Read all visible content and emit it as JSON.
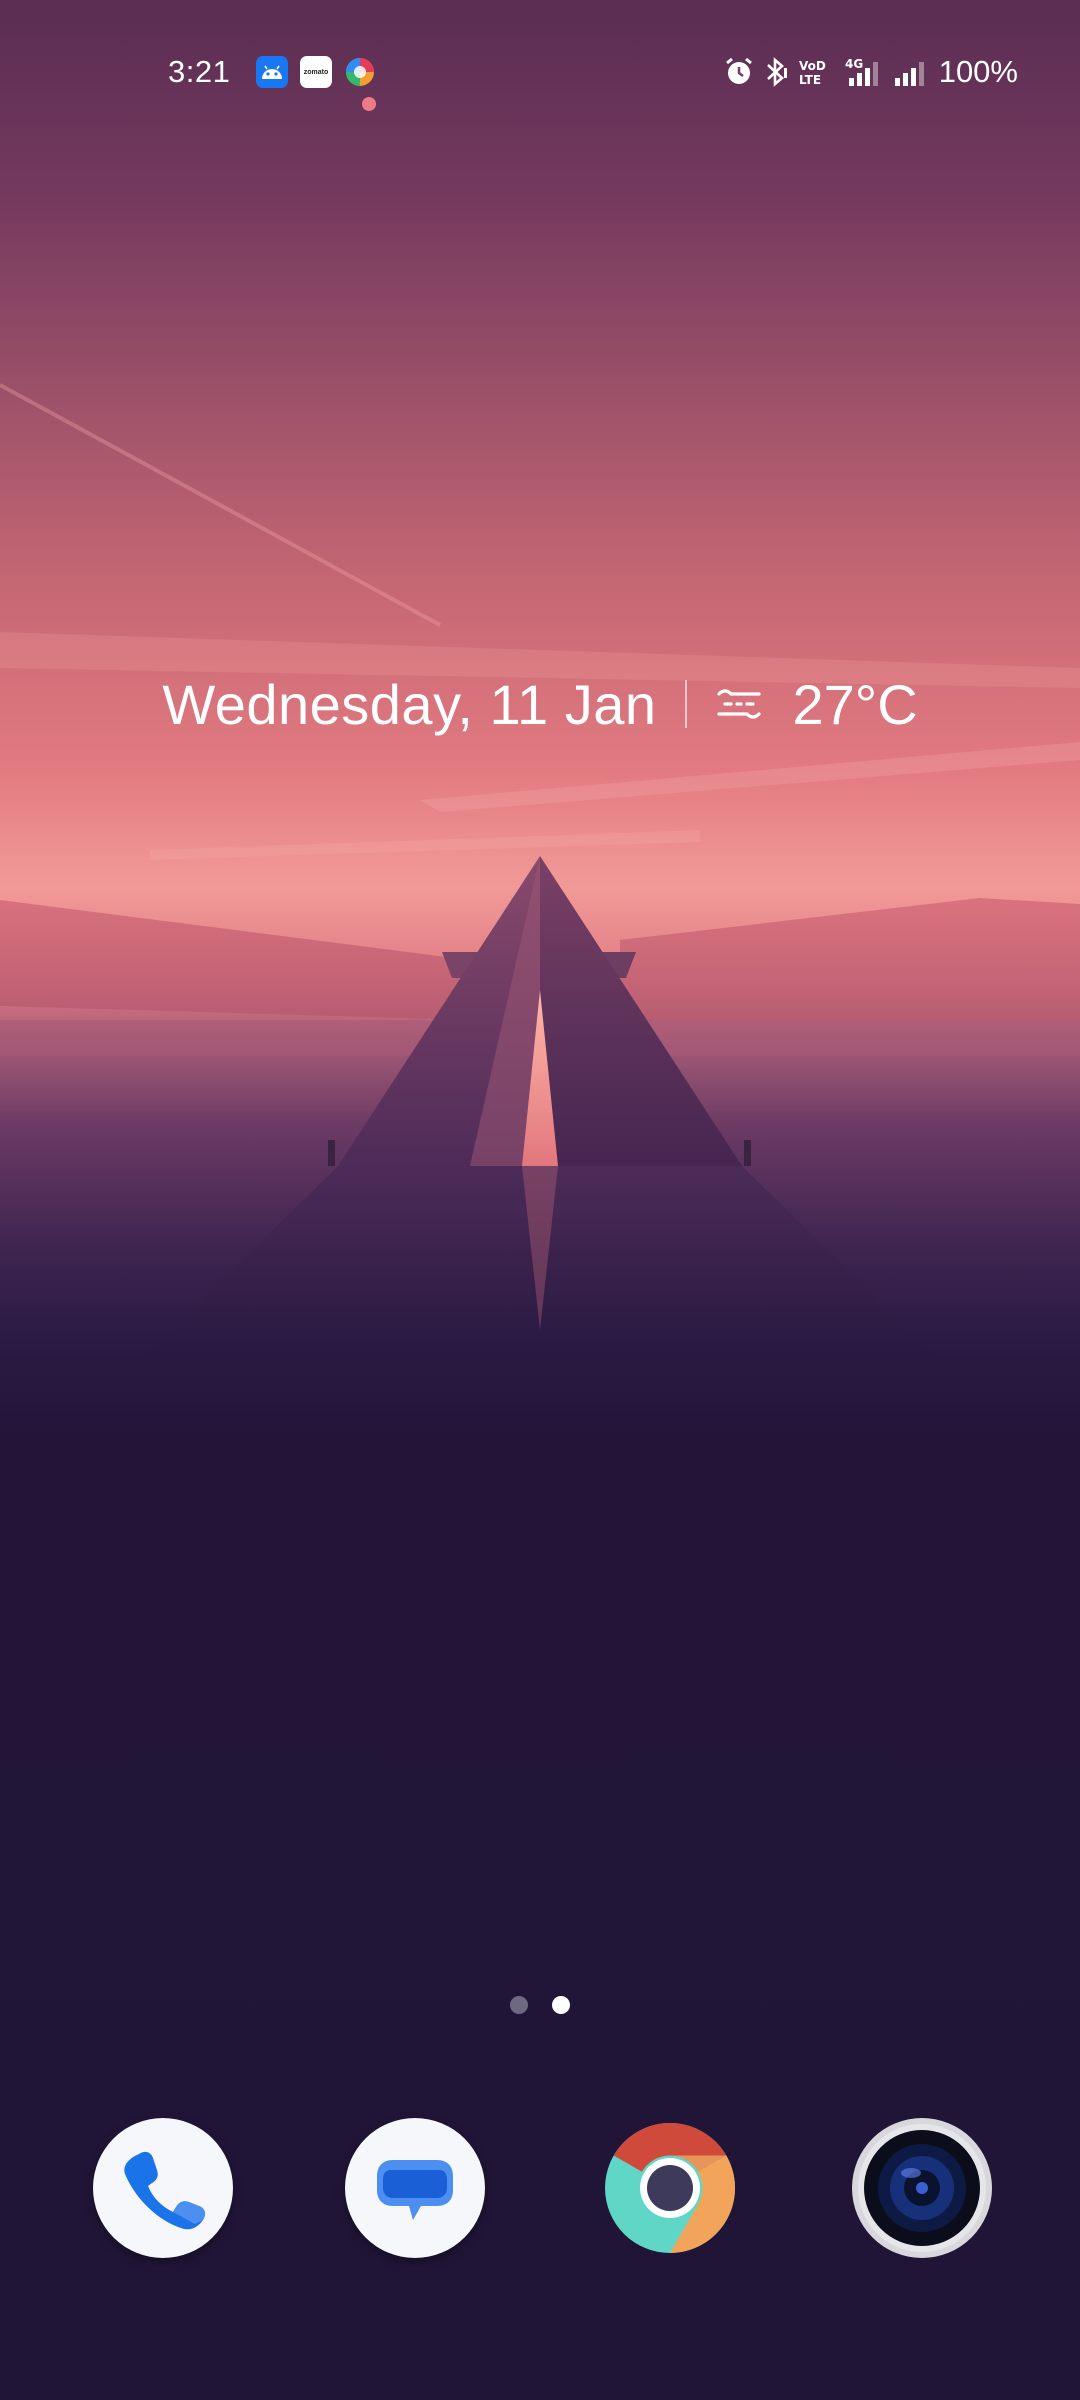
{
  "status_bar": {
    "time": "3:21",
    "notification_icons": [
      "android-app-icon",
      "zomato-icon",
      "photos-icon"
    ],
    "system_icons": [
      "alarm-icon",
      "bluetooth-icon",
      "volte-icon",
      "signal-4g-icon",
      "signal-icon"
    ],
    "volte_label": "Vo LTE",
    "network_label": "4G",
    "battery": "100%"
  },
  "widget": {
    "date": "Wednesday, 11 Jan",
    "weather_icon": "haze-icon",
    "temperature": "27°C"
  },
  "page_indicator": {
    "pages": 2,
    "current": 2
  },
  "dock": {
    "apps": [
      {
        "name": "Phone",
        "icon": "phone-icon"
      },
      {
        "name": "Messages",
        "icon": "messages-icon"
      },
      {
        "name": "Chrome",
        "icon": "chrome-icon"
      },
      {
        "name": "Camera",
        "icon": "camera-icon"
      }
    ]
  },
  "colors": {
    "sky_top": "#5a2d52",
    "horizon": "#f29a98",
    "ground": "#201537",
    "phone_blue": "#1a73e8",
    "messages_blue": "#1a73e8"
  }
}
